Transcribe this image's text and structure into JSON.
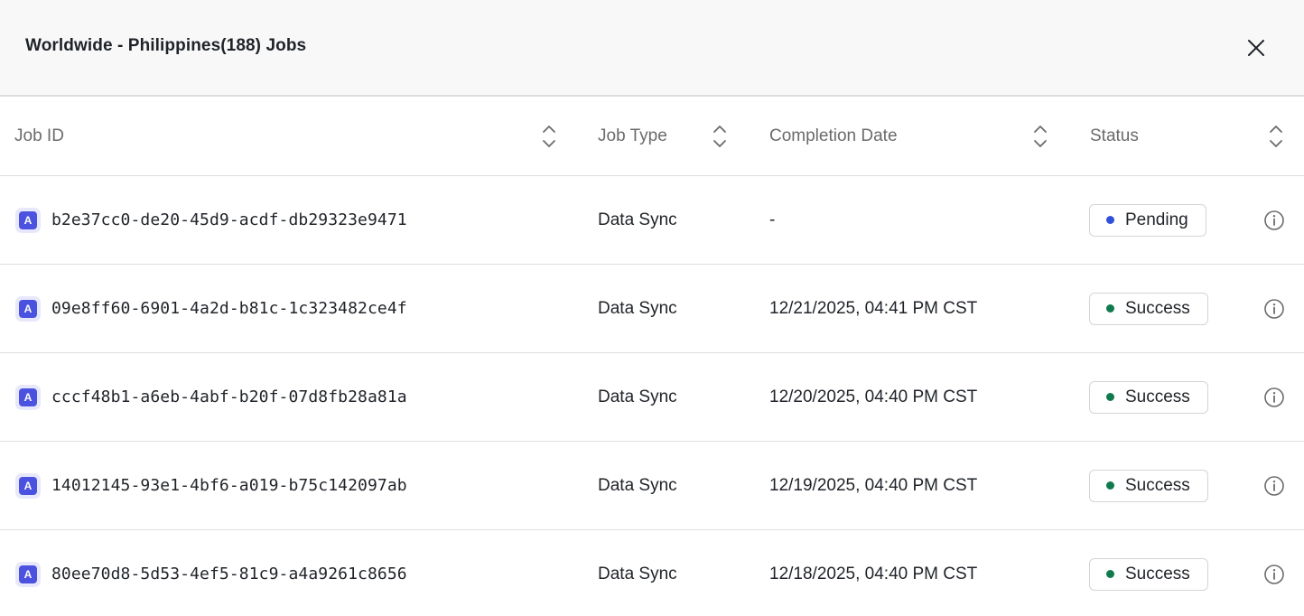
{
  "modal": {
    "title": "Worldwide - Philippines(188) Jobs",
    "close_icon": "close-icon"
  },
  "table": {
    "columns": {
      "job_id": "Job ID",
      "job_type": "Job Type",
      "completion_date": "Completion Date",
      "status": "Status"
    },
    "job_icon_letter": "A",
    "rows": [
      {
        "job_id": "b2e37cc0-de20-45d9-acdf-db29323e9471",
        "job_type": "Data Sync",
        "completion_date": "-",
        "status": "Pending",
        "status_color": "#2f50d8"
      },
      {
        "job_id": "09e8ff60-6901-4a2d-b81c-1c323482ce4f",
        "job_type": "Data Sync",
        "completion_date": "12/21/2025, 04:41 PM CST",
        "status": "Success",
        "status_color": "#0f7a4c"
      },
      {
        "job_id": "cccf48b1-a6eb-4abf-b20f-07d8fb28a81a",
        "job_type": "Data Sync",
        "completion_date": "12/20/2025, 04:40 PM CST",
        "status": "Success",
        "status_color": "#0f7a4c"
      },
      {
        "job_id": "14012145-93e1-4bf6-a019-b75c142097ab",
        "job_type": "Data Sync",
        "completion_date": "12/19/2025, 04:40 PM CST",
        "status": "Success",
        "status_color": "#0f7a4c"
      },
      {
        "job_id": "80ee70d8-5d53-4ef5-81c9-a4a9261c8656",
        "job_type": "Data Sync",
        "completion_date": "12/18/2025, 04:40 PM CST",
        "status": "Success",
        "status_color": "#0f7a4c"
      }
    ]
  }
}
